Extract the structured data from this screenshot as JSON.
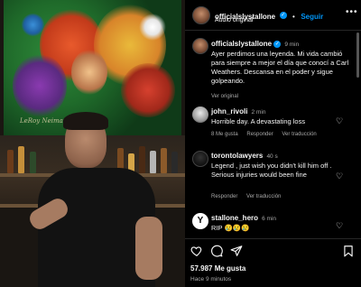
{
  "post": {
    "author": "officialslystallone",
    "verified_mark": "✓",
    "follow_label": "Seguir",
    "audio_label": "Audio original",
    "more_icon": "more-horizontal-icon",
    "caption": "Ayer perdimos una leyenda. Mi vida cambió para siempre a mejor el día que conocí a Carl Weathers. Descansa en el poder y sigue golpeando.",
    "caption_time": "9 min",
    "see_translation": "Ver original",
    "painting_signature": "LeRoy Neiman",
    "likes": "57.987 Me gusta",
    "posted_ago": "Hace 9 minutos"
  },
  "comments": [
    {
      "author": "john_rivoli",
      "time": "2 min",
      "text": "Horrible day. A devastating loss",
      "likes": "8 Me gusta",
      "reply_label": "Responder",
      "translate_label": "Ver traducción"
    },
    {
      "author": "torontolawyers",
      "time": "40 s",
      "text": "Legend , just wish you didn't kill him off . Serious injuries would been fine",
      "reply_label": "Responder",
      "translate_label": "Ver traducción"
    },
    {
      "author": "stallone_hero",
      "time": "6 min",
      "text": "RIP 😢😢😢"
    }
  ],
  "icons": {
    "like": "heart-icon",
    "comment": "comment-icon",
    "share": "send-icon",
    "save": "bookmark-icon"
  },
  "colors": {
    "background": "#000000",
    "text": "#f5f5f5",
    "muted": "#a8a8a8",
    "accent": "#0095f6",
    "divider": "#262626"
  }
}
